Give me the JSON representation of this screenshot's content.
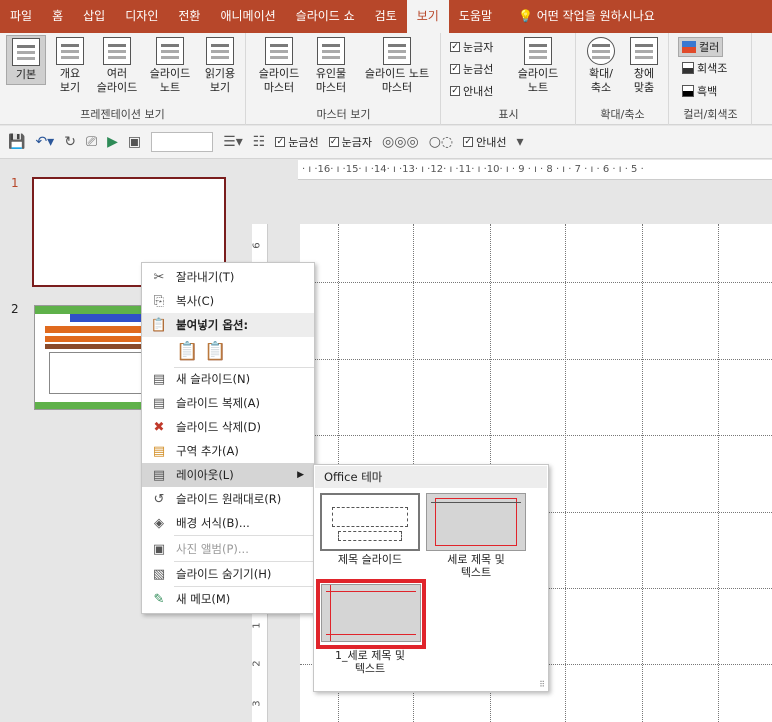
{
  "tabs": [
    "파일",
    "홈",
    "삽입",
    "디자인",
    "전환",
    "애니메이션",
    "슬라이드 쇼",
    "검토",
    "보기",
    "도움말"
  ],
  "tell_me": "어떤 작업을 원하시나요",
  "ribbon": {
    "presentation_views": {
      "label": "프레젠테이션 보기",
      "buttons": [
        "기본",
        "개요\n보기",
        "여러\n슬라이드",
        "슬라이드\n노트",
        "읽기용\n보기"
      ]
    },
    "master_views": {
      "label": "마스터 보기",
      "buttons": [
        "슬라이드\n마스터",
        "유인물\n마스터",
        "슬라이드 노트\n마스터"
      ]
    },
    "show": {
      "label": "표시",
      "checks": [
        "눈금자",
        "눈금선",
        "안내선"
      ],
      "notes": "슬라이드\n노트"
    },
    "zoom": {
      "label": "확대/축소",
      "buttons": [
        "확대/\n축소",
        "창에\n맞춤"
      ]
    },
    "color": {
      "label": "컬러/회색조",
      "options": [
        "컬러",
        "회색조",
        "흑백"
      ]
    }
  },
  "qat": {
    "checks": [
      "눈금선",
      "눈금자",
      "안내선"
    ]
  },
  "ruler_top": "· ı ·16· ı ·15· ı ·14· ı ·13· ı ·12· ı ·11· ı ·10· ı · 9 · ı · 8 · ı · 7 · ı · 6 · ı · 5 ·",
  "ruler_left": [
    "6",
    "1",
    "2",
    "3"
  ],
  "slides": [
    "1",
    "2"
  ],
  "context_menu": [
    {
      "label": "잘라내기(T)",
      "icon": "✂",
      "state": "normal"
    },
    {
      "label": "복사(C)",
      "icon": "⎘",
      "state": "normal"
    },
    {
      "label": "붙여넣기 옵션:",
      "icon": "📋",
      "state": "header"
    },
    {
      "label": "새 슬라이드(N)",
      "icon": "▤",
      "state": "normal"
    },
    {
      "label": "슬라이드 복제(A)",
      "icon": "▤",
      "state": "normal"
    },
    {
      "label": "슬라이드 삭제(D)",
      "icon": "✖",
      "state": "normal"
    },
    {
      "label": "구역 추가(A)",
      "icon": "▤",
      "state": "normal"
    },
    {
      "label": "레이아웃(L)",
      "icon": "▤",
      "state": "highlight"
    },
    {
      "label": "슬라이드 원래대로(R)",
      "icon": "↺",
      "state": "normal"
    },
    {
      "label": "배경 서식(B)...",
      "icon": "◈",
      "state": "normal"
    },
    {
      "label": "사진 앨범(P)...",
      "icon": "▣",
      "state": "disabled"
    },
    {
      "label": "슬라이드 숨기기(H)",
      "icon": "▧",
      "state": "normal"
    },
    {
      "label": "새 메모(M)",
      "icon": "✎",
      "state": "normal"
    }
  ],
  "submenu": {
    "header": "Office 테마",
    "layouts": [
      "제목 슬라이드",
      "세로 제목 및\n텍스트",
      "1_세로 제목 및\n텍스트"
    ]
  },
  "colors": {
    "accent": "#b7472a",
    "highlight_box": "#e0242b",
    "slide_border": "#7a1d1d"
  }
}
